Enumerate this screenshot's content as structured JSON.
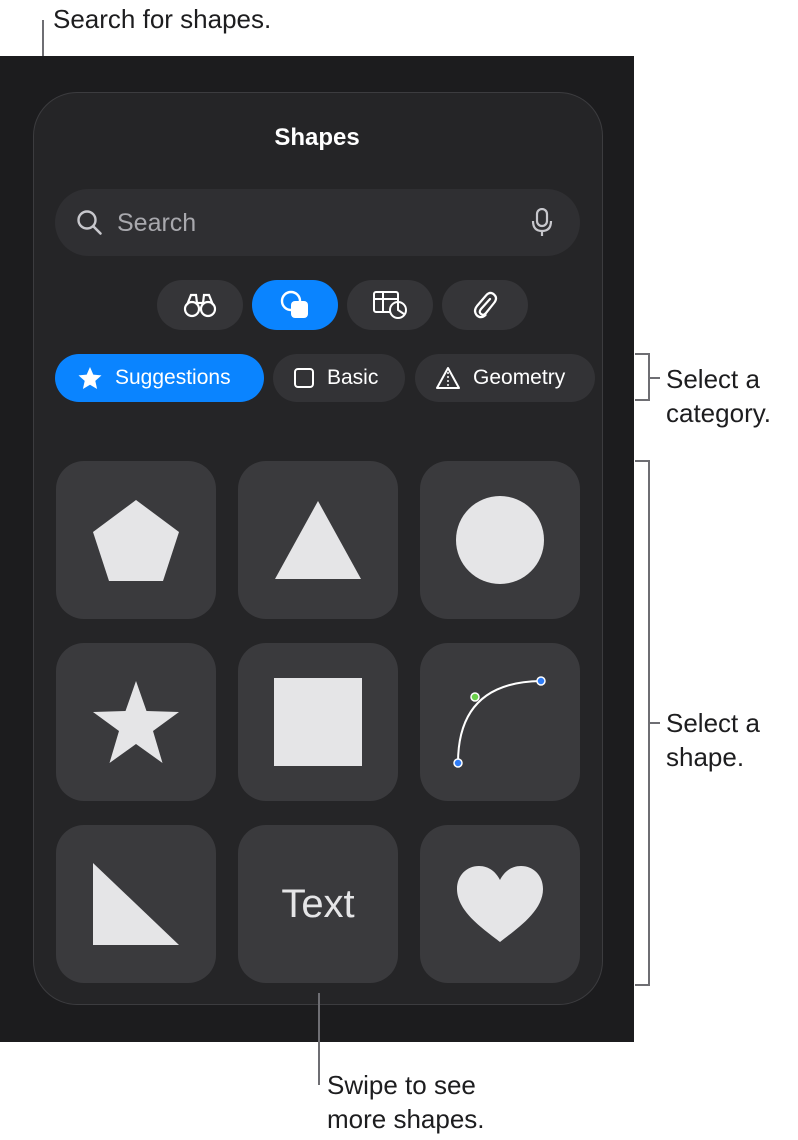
{
  "annotations": {
    "search": "Search for shapes.",
    "category_line1": "Select a",
    "category_line2": "category.",
    "shape_line1": "Select a",
    "shape_line2": "shape.",
    "swipe_line1": "Swipe to see",
    "swipe_line2": "more shapes."
  },
  "panel": {
    "title": "Shapes",
    "search_placeholder": "Search",
    "tabs": [
      {
        "icon": "binoculars-icon",
        "active": false
      },
      {
        "icon": "shapes-icon",
        "active": true
      },
      {
        "icon": "table-chart-icon",
        "active": false
      },
      {
        "icon": "paperclip-icon",
        "active": false
      }
    ],
    "categories": [
      {
        "label": "Suggestions",
        "icon": "star-icon",
        "active": true
      },
      {
        "label": "Basic",
        "icon": "square-outline-icon",
        "active": false
      },
      {
        "label": "Geometry",
        "icon": "pyramid-icon",
        "active": false
      }
    ],
    "shapes": [
      {
        "name": "pentagon"
      },
      {
        "name": "triangle"
      },
      {
        "name": "circle"
      },
      {
        "name": "star"
      },
      {
        "name": "square"
      },
      {
        "name": "curve"
      },
      {
        "name": "right-triangle"
      },
      {
        "name": "text",
        "label": "Text"
      },
      {
        "name": "heart"
      }
    ]
  },
  "colors": {
    "accent": "#0a84ff",
    "panel": "#252527",
    "tile": "#3a3a3d",
    "shape_fill": "#e5e5e7"
  }
}
